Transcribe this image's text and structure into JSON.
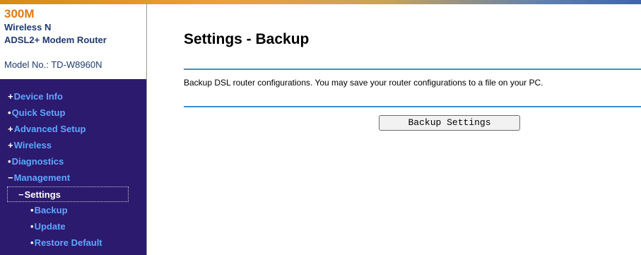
{
  "brand": {
    "model_size": "300M",
    "line1": "Wireless N",
    "line2": "ADSL2+ Modem Router",
    "model": "Model No.: TD-W8960N"
  },
  "sidebar": {
    "items": [
      {
        "marker": "+",
        "label": "Device Info"
      },
      {
        "marker": "•",
        "label": "Quick Setup"
      },
      {
        "marker": "+",
        "label": "Advanced Setup"
      },
      {
        "marker": "+",
        "label": "Wireless"
      },
      {
        "marker": "•",
        "label": "Diagnostics"
      },
      {
        "marker": "−",
        "label": "Management"
      },
      {
        "marker": "−",
        "label": "Settings"
      },
      {
        "marker": "•",
        "label": "Backup"
      },
      {
        "marker": "•",
        "label": "Update"
      },
      {
        "marker": "•",
        "label": "Restore Default"
      }
    ]
  },
  "main": {
    "title": "Settings - Backup",
    "description": "Backup DSL router configurations. You may save your router configurations to a file on your PC.",
    "button_label": "Backup Settings"
  },
  "colors": {
    "sidebar_bg": "#2b1a6e",
    "nav_text": "#5fa7ff",
    "accent_line": "#3a8fd0",
    "brand_orange": "#e07a12"
  }
}
